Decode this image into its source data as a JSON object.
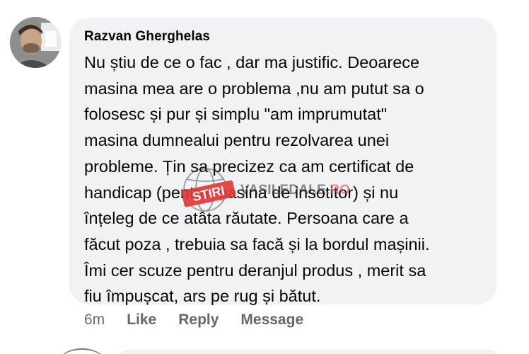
{
  "comment": {
    "author": "Razvan Gherghelas",
    "lines": [
      "Nu știu de ce o fac , dar ma justific. Deoarece",
      "masina mea are o problema ,nu am putut sa o",
      "folosesc și pur și simplu \"am imprumutat\"",
      "masina dumnealui pentru rezolvarea unei",
      "probleme. Țin sa precizez ca am certificat de",
      "handicap (pentru masina de insotitor) și nu",
      "înțeleg de ce atâta răutate. Persoana care a",
      "făcut poza , trebuia sa facă și la bordul mașinii.",
      "Îmi cer scuze pentru deranjul produs , merit sa",
      "fiu împușcat, ars pe rug și bătut."
    ]
  },
  "actions": {
    "time": "6m",
    "like": "Like",
    "reply": "Reply",
    "message": "Message"
  },
  "watermark": {
    "badge": "STIRI",
    "site_main": "VASILEDALE",
    "site_tld": ".RO"
  },
  "colors": {
    "bubble": "#f0f2f5",
    "text": "#050505",
    "secondary": "#65676b",
    "watermark_red": "#e53935"
  }
}
